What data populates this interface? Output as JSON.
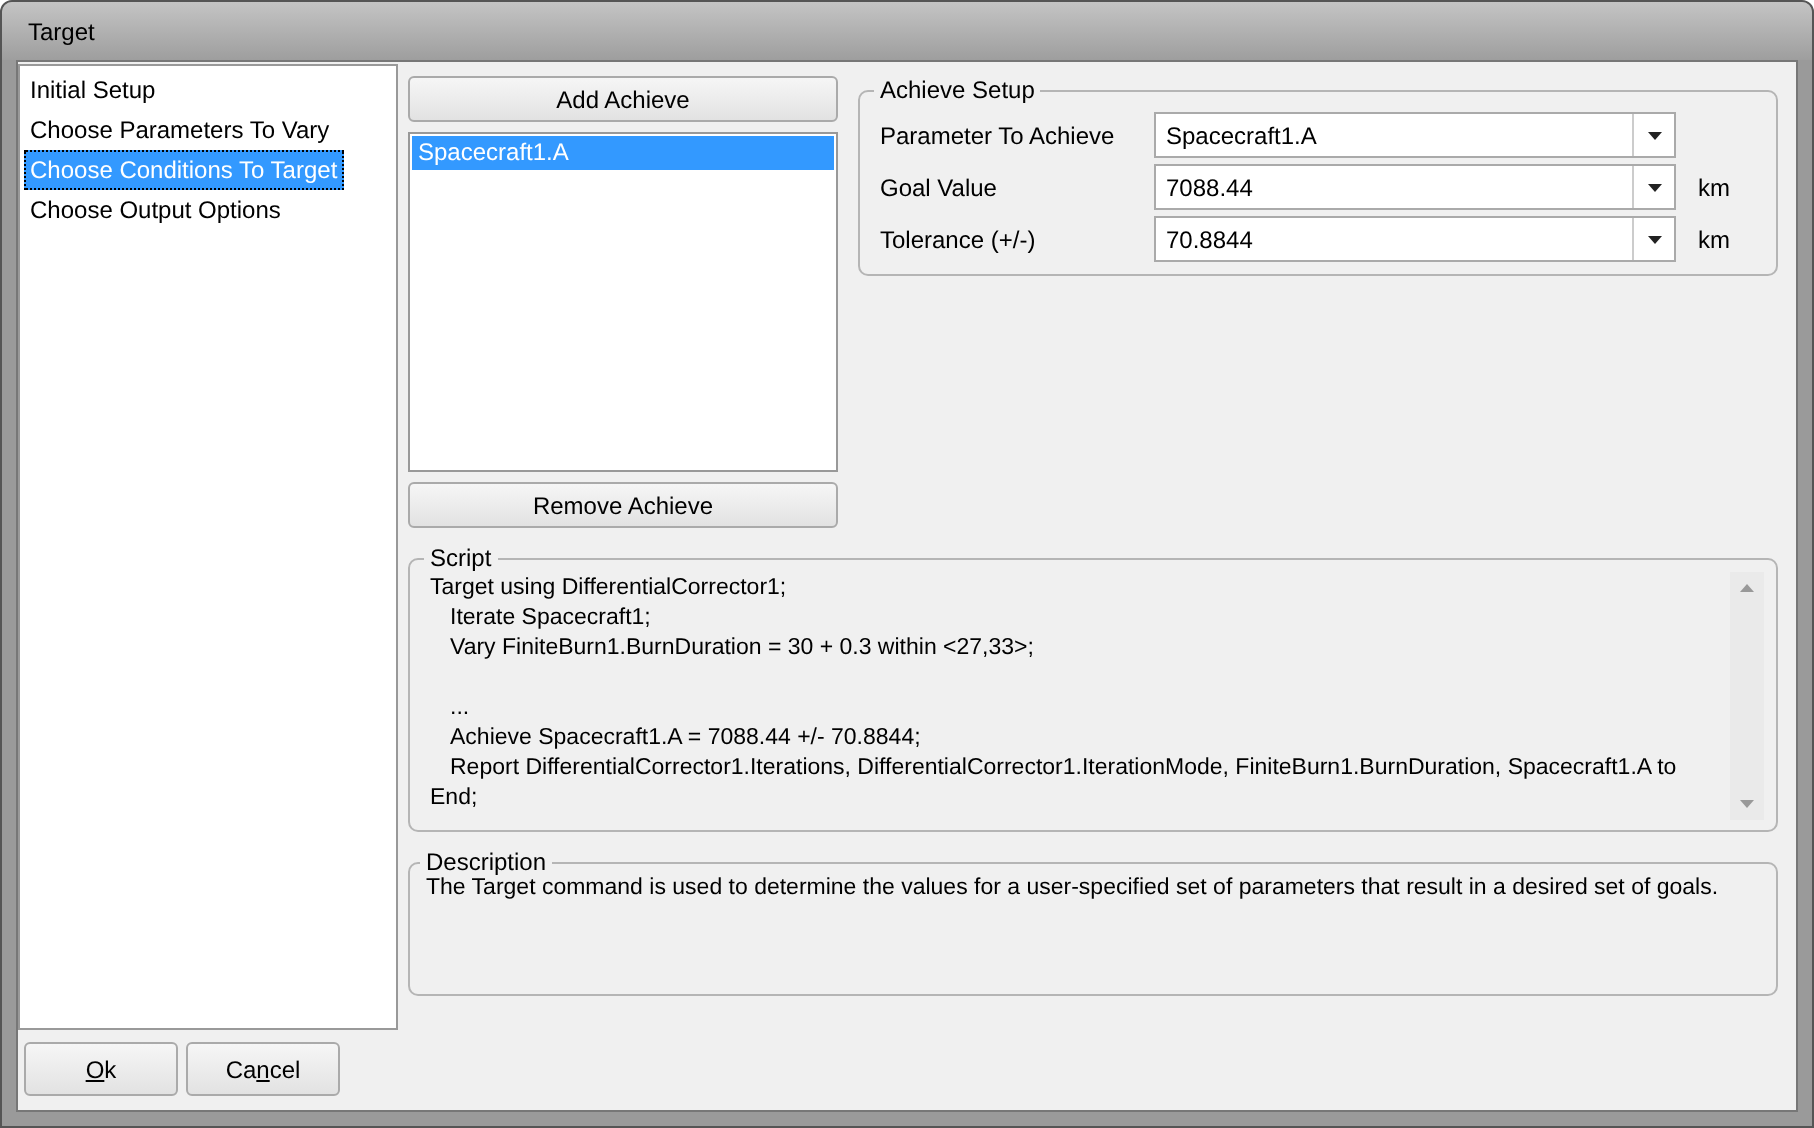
{
  "window": {
    "title": "Target"
  },
  "nav": {
    "items": [
      {
        "label": "Initial Setup",
        "selected": false
      },
      {
        "label": "Choose Parameters To Vary",
        "selected": false
      },
      {
        "label": "Choose Conditions To Target",
        "selected": true
      },
      {
        "label": "Choose Output Options",
        "selected": false
      }
    ]
  },
  "achieve_list": {
    "add_button": "Add Achieve",
    "items": [
      {
        "label": "Spacecraft1.A",
        "selected": true
      }
    ],
    "remove_button": "Remove Achieve"
  },
  "achieve_setup": {
    "title": "Achieve Setup",
    "fields": [
      {
        "label": "Parameter To Achieve",
        "value": "Spacecraft1.A"
      },
      {
        "label": "Goal Value",
        "value": "7088.44",
        "unit": "km"
      },
      {
        "label": "Tolerance (+/-)",
        "value": "70.8844",
        "unit": "km"
      }
    ]
  },
  "script": {
    "title": "Script",
    "lines": [
      {
        "text": "Target using DifferentialCorrector1;",
        "indented": false,
        "gap_before": false
      },
      {
        "text": "Iterate Spacecraft1;",
        "indented": true,
        "gap_before": false
      },
      {
        "text": "Vary FiniteBurn1.BurnDuration = 30 + 0.3 within <27,33>;",
        "indented": true,
        "gap_before": false
      },
      {
        "text": "...",
        "indented": true,
        "gap_before": true
      },
      {
        "text": "Achieve Spacecraft1.A = 7088.44 +/- 70.8844;",
        "indented": true,
        "gap_before": false
      },
      {
        "text": "Report DifferentialCorrector1.Iterations, DifferentialCorrector1.IterationMode, FiniteBurn1.BurnDuration, Spacecraft1.A to",
        "indented": true,
        "gap_before": false
      },
      {
        "text": "End;",
        "indented": false,
        "gap_before": false
      }
    ]
  },
  "description": {
    "title": "Description",
    "text": "The Target command is used to determine the values for a user-specified set of parameters that result in a desired set of goals."
  },
  "buttons": [
    {
      "label_parts": [
        {
          "text": "O",
          "underlined": true
        },
        {
          "text": "k",
          "underlined": false
        }
      ]
    },
    {
      "label_parts": [
        {
          "text": "Ca",
          "underlined": false
        },
        {
          "text": "n",
          "underlined": true
        },
        {
          "text": "cel",
          "underlined": false
        }
      ]
    }
  ]
}
